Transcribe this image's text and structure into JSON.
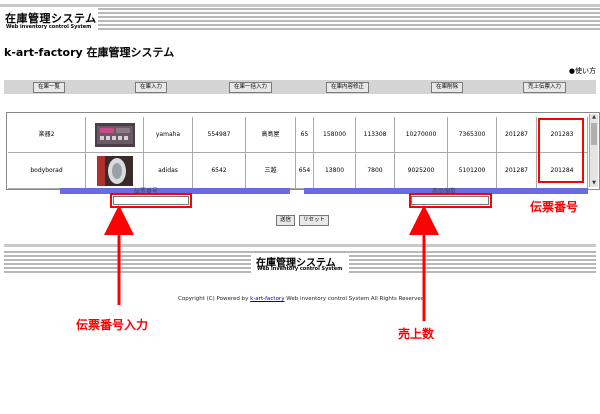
{
  "header": {
    "logo_title": "在庫管理システム",
    "logo_subtitle": "Web inventory control System",
    "page_title": "k-art-factory 在庫管理システム",
    "help_link": "●使い方"
  },
  "nav": {
    "items": [
      "在庫一覧",
      "在庫入力",
      "在庫一括入力",
      "在庫内容修正",
      "在庫削除",
      "売上伝票入力"
    ]
  },
  "table": {
    "rows": [
      {
        "name": "楽器2",
        "image": "drum-machine-thumbnail",
        "maker": "yamaha",
        "code": "554987",
        "store": "高島屋",
        "qty": "65",
        "price": "158000",
        "cost": "113308",
        "total": "10270000",
        "cost_total": "7365300",
        "date": "201287",
        "slip_no": "201283"
      },
      {
        "name": "bodyborad",
        "image": "bodyboard-thumbnail",
        "maker": "adidas",
        "code": "6542",
        "store": "三越",
        "qty": "654",
        "price": "13800",
        "cost": "7800",
        "total": "9025200",
        "cost_total": "5101200",
        "date": "201287",
        "slip_no": "201284"
      }
    ],
    "col_labels": {
      "slip_input_label": "伝票番号",
      "sales_qty_label": "商品個数"
    },
    "inputs": {
      "slip_input_value": "",
      "sales_qty_value": ""
    }
  },
  "buttons": {
    "submit": "送信",
    "reset": "リセット"
  },
  "annotations": {
    "slip_no": "伝票番号",
    "slip_input": "伝票番号入力",
    "sales_qty": "売上数"
  },
  "footer": {
    "logo_title": "在庫管理システム",
    "logo_subtitle": "Web inventory control System",
    "copyright_prefix": "Copyright (C) Powered by ",
    "copyright_link": "k-art-factory",
    "copyright_suffix": " Web inventory control System  All Rights Reserved."
  },
  "colors": {
    "annotation": "#ff0000",
    "column_strip": "#6b6be0"
  }
}
